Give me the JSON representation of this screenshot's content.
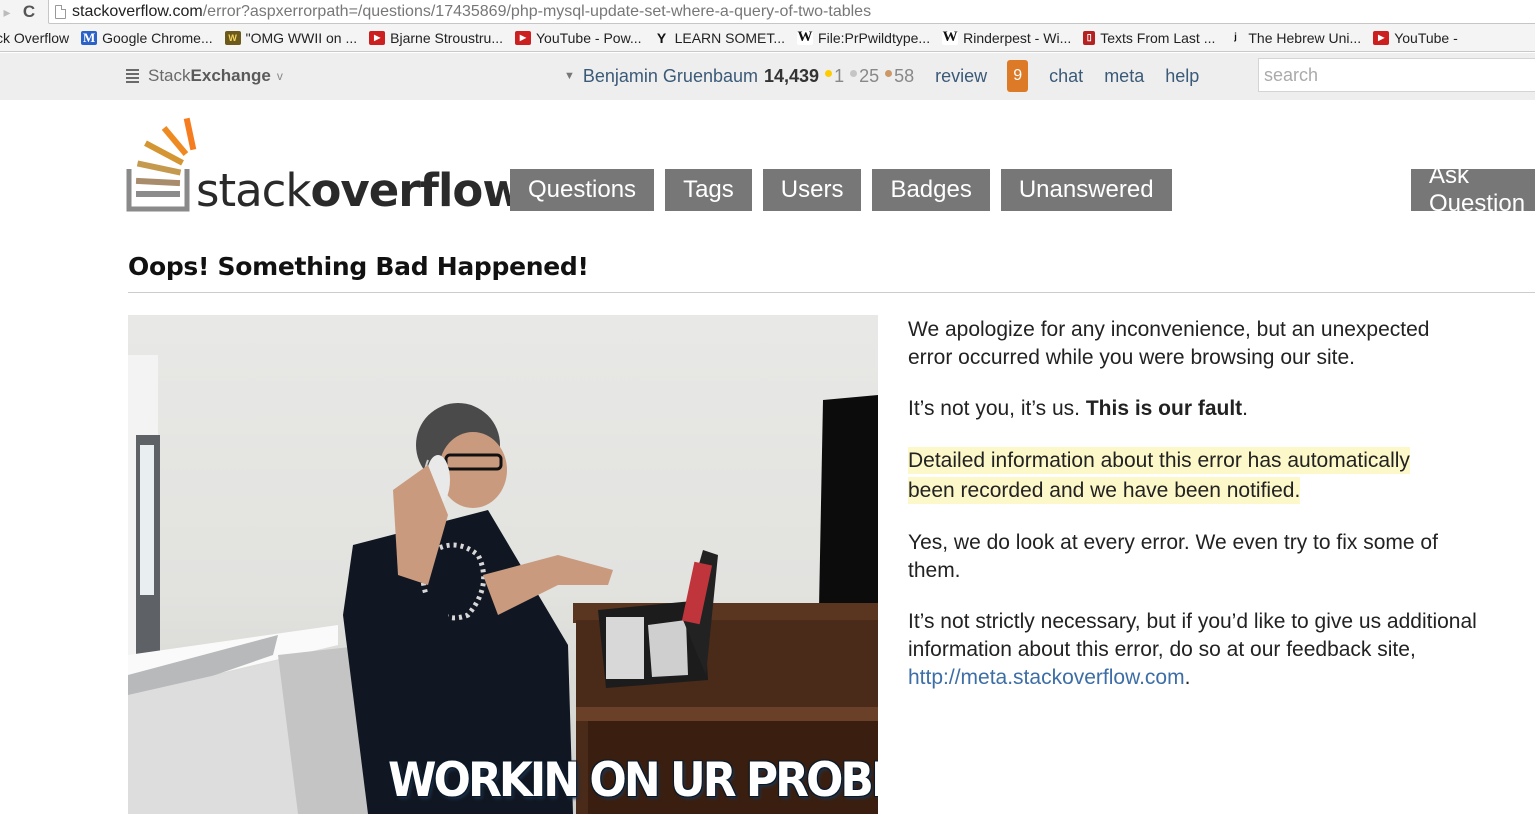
{
  "browser": {
    "url_host": "stackoverflow.com",
    "url_path": "/error?aspxerrorpath=/questions/17435869/php-mysql-update-set-where-a-query-of-two-tables",
    "bookmarks": [
      {
        "icon": "none",
        "label": "ck Overflow"
      },
      {
        "icon": "gmail-m-icon",
        "label": "Google Chrome..."
      },
      {
        "icon": "omg-icon",
        "label": "\"OMG WWII on ..."
      },
      {
        "icon": "youtube-icon",
        "label": "Bjarne Stroustru..."
      },
      {
        "icon": "youtube-icon",
        "label": "YouTube - Pow..."
      },
      {
        "icon": "ycombinator-icon",
        "label": "LEARN SOMET..."
      },
      {
        "icon": "wikipedia-icon",
        "label": "File:PrPwildtype..."
      },
      {
        "icon": "wikipedia-icon",
        "label": "Rinderpest - Wi..."
      },
      {
        "icon": "tfln-icon",
        "label": "Texts From Last ..."
      },
      {
        "icon": "huji-icon",
        "label": "The Hebrew Uni..."
      },
      {
        "icon": "youtube-icon",
        "label": "YouTube -"
      }
    ]
  },
  "topbar": {
    "brand_light": "Stack",
    "brand_bold": "Exchange",
    "brand_caret": "v",
    "user_caret": "▼",
    "user_name": "Benjamin Gruenbaum",
    "reputation": "14,439",
    "badges": {
      "gold": {
        "count": "1",
        "color": "#ffcc01"
      },
      "silver": {
        "count": "25",
        "color": "#c5c5c5"
      },
      "bronze": {
        "count": "58",
        "color": "#cc9966"
      }
    },
    "review_label": "review",
    "review_count": "9",
    "review_count_color": "#dc7a27",
    "chat_label": "chat",
    "meta_label": "meta",
    "help_label": "help",
    "search_placeholder": "search"
  },
  "header": {
    "logo_light": "stack",
    "logo_bold": "overflow",
    "nav": [
      "Questions",
      "Tags",
      "Users",
      "Badges",
      "Unanswered"
    ],
    "ask_question": "Ask Question"
  },
  "main": {
    "title": "Oops! Something Bad Happened!",
    "image_caption": "WORKIN ON UR PROBLEMZ",
    "p1": "We apologize for any inconvenience, but an unexpected error occurred while you were browsing our site.",
    "p2_plain": "It’s not you, it’s us. ",
    "p2_bold": "This is our fault",
    "p2_end": ".",
    "p3_highlight": " Detailed information about this error has automatically been recorded and we have been notified.",
    "p4": "Yes, we do look at every error. We even try to fix some of them.",
    "p5_plain": "It’s not strictly necessary, but if you’d like to give us additional information about this error, do so at our feedback site, ",
    "p5_link": "http://meta.stackoverflow.com",
    "p5_end": "."
  }
}
